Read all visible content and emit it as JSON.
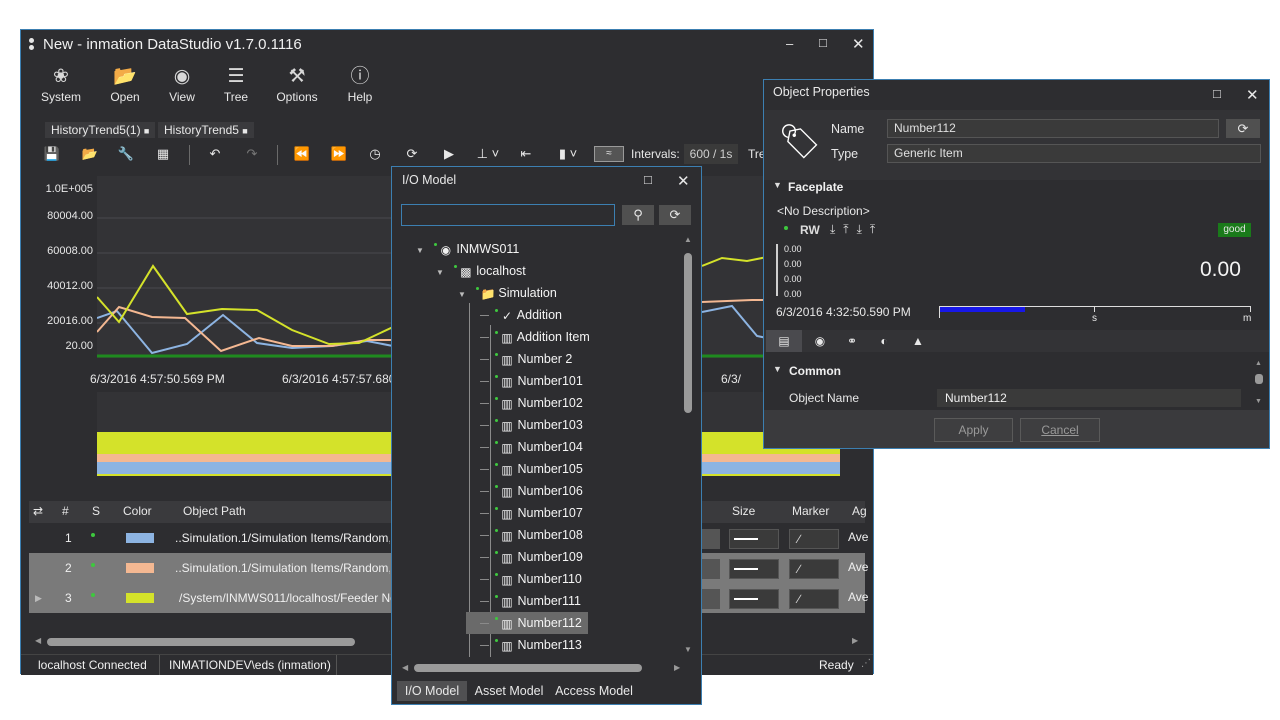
{
  "main": {
    "title": "New - inmation DataStudio v1.7.0.1116",
    "menu": [
      {
        "label": "System",
        "icon": "system-icon"
      },
      {
        "label": "Open",
        "icon": "folder-icon"
      },
      {
        "label": "View",
        "icon": "eye-icon"
      },
      {
        "label": "Tree",
        "icon": "tree-icon"
      },
      {
        "label": "Options",
        "icon": "tools-icon"
      },
      {
        "label": "Help",
        "icon": "help-icon"
      }
    ],
    "tabs": [
      "HistoryTrend5(1)",
      "HistoryTrend5"
    ],
    "toolbar": {
      "intervals_label": "Intervals:",
      "intervals_value": "600 / 1s",
      "truncated": "Tre"
    },
    "chart": {
      "yticks": [
        "1.0E+005",
        "80004.00",
        "60008.00",
        "40012.00",
        "20016.00",
        "20.00"
      ],
      "xticks": [
        "6/3/2016 4:57:50.569 PM",
        "6/3/2016 4:57:57.680",
        "6/3/"
      ]
    },
    "table": {
      "headers": [
        "#",
        "S",
        "Color",
        "Object Path",
        "Size",
        "Marker",
        "Ag"
      ],
      "rows": [
        {
          "num": "1",
          "color": "#8db4e2",
          "path": "..Simulation.1/Simulation Items/Random,",
          "agg": "Ave"
        },
        {
          "num": "2",
          "color": "#f4b892",
          "path": "..Simulation.1/Simulation Items/Random,",
          "agg": "Ave"
        },
        {
          "num": "3",
          "color": "#d4e22a",
          "path": "/System/INMWS011/localhost/Feeder Ne",
          "agg": "Ave"
        }
      ]
    },
    "status": {
      "connection": "localhost  Connected",
      "user": "INMATIONDEV\\eds (inmation)",
      "ready": "Ready"
    }
  },
  "io_model": {
    "title": "I/O Model",
    "search_value": "",
    "tree": [
      {
        "label": "INMWS011",
        "level": 0,
        "icon": "core-icon",
        "expand": true
      },
      {
        "label": "localhost",
        "level": 1,
        "icon": "connector-icon",
        "expand": true
      },
      {
        "label": "Simulation",
        "level": 2,
        "icon": "folder-icon",
        "expand": true
      },
      {
        "label": "Addition",
        "level": 3,
        "icon": "action-icon"
      },
      {
        "label": "Addition Item",
        "level": 3,
        "icon": "item-icon"
      },
      {
        "label": "Number 2",
        "level": 3,
        "icon": "item-icon"
      },
      {
        "label": "Number101",
        "level": 3,
        "icon": "item-icon"
      },
      {
        "label": "Number102",
        "level": 3,
        "icon": "item-icon"
      },
      {
        "label": "Number103",
        "level": 3,
        "icon": "item-icon"
      },
      {
        "label": "Number104",
        "level": 3,
        "icon": "item-icon"
      },
      {
        "label": "Number105",
        "level": 3,
        "icon": "item-icon"
      },
      {
        "label": "Number106",
        "level": 3,
        "icon": "item-icon"
      },
      {
        "label": "Number107",
        "level": 3,
        "icon": "item-icon"
      },
      {
        "label": "Number108",
        "level": 3,
        "icon": "item-icon"
      },
      {
        "label": "Number109",
        "level": 3,
        "icon": "item-icon"
      },
      {
        "label": "Number110",
        "level": 3,
        "icon": "item-icon"
      },
      {
        "label": "Number111",
        "level": 3,
        "icon": "item-icon"
      },
      {
        "label": "Number112",
        "level": 3,
        "icon": "item-icon",
        "selected": true
      },
      {
        "label": "Number113",
        "level": 3,
        "icon": "item-icon"
      }
    ],
    "tabs": [
      "I/O Model",
      "Asset Model",
      "Access Model"
    ]
  },
  "props": {
    "title": "Object Properties",
    "name_label": "Name",
    "name_value": "Number112",
    "type_label": "Type",
    "type_value": "Generic Item",
    "faceplate": "Faceplate",
    "description": "<No Description>",
    "rw": "RW",
    "quality": "good",
    "mini_values": [
      "0.00",
      "0.00",
      "0.00",
      "0.00"
    ],
    "big_value": "0.00",
    "timestamp": "6/3/2016 4:32:50.590 PM",
    "scale": [
      "s",
      "m"
    ],
    "common": "Common",
    "object_name_label": "Object Name",
    "object_name_value": "Number112",
    "apply": "Apply",
    "cancel": "Cancel"
  }
}
